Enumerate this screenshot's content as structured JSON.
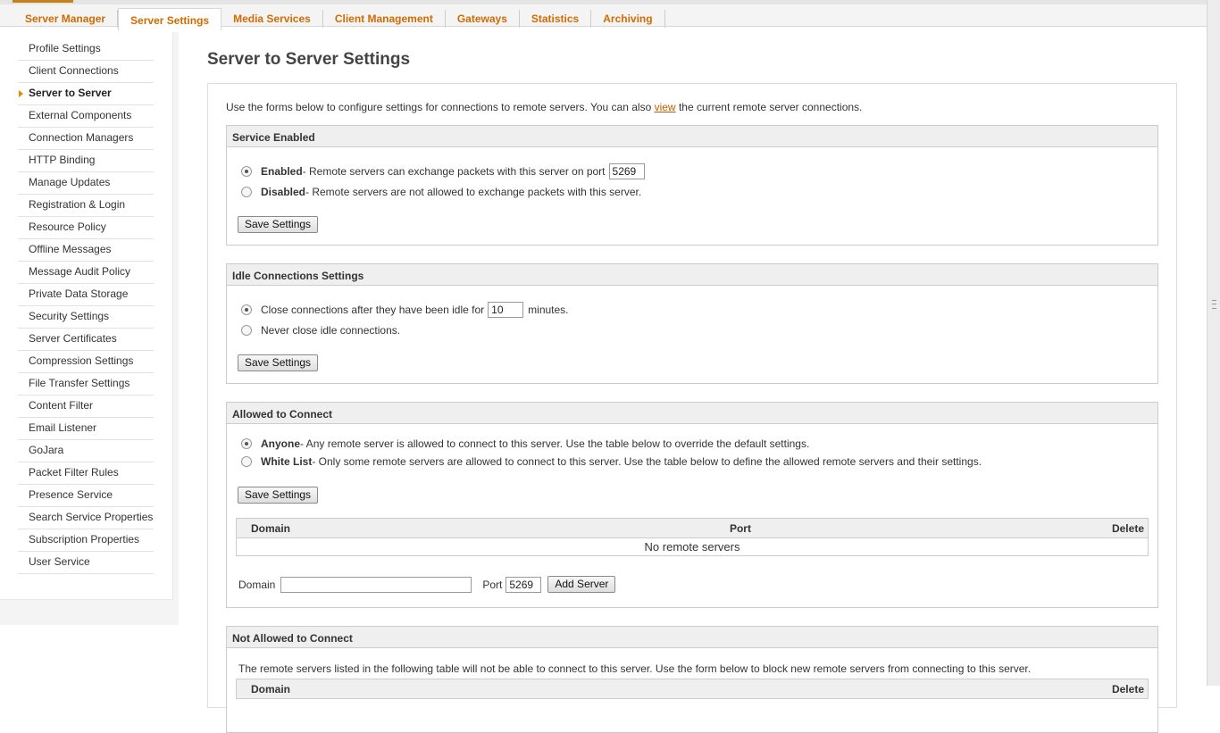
{
  "tabs": [
    {
      "label": "Server Manager",
      "active": false
    },
    {
      "label": "Server Settings",
      "active": true
    },
    {
      "label": "Media Services",
      "active": false
    },
    {
      "label": "Client Management",
      "active": false
    },
    {
      "label": "Gateways",
      "active": false
    },
    {
      "label": "Statistics",
      "active": false
    },
    {
      "label": "Archiving",
      "active": false
    }
  ],
  "sidebar": {
    "items": [
      {
        "label": "Profile Settings"
      },
      {
        "label": "Client Connections"
      },
      {
        "label": "Server to Server",
        "active": true
      },
      {
        "label": "External Components"
      },
      {
        "label": "Connection Managers"
      },
      {
        "label": "HTTP Binding"
      },
      {
        "label": "Manage Updates"
      },
      {
        "label": "Registration & Login"
      },
      {
        "label": "Resource Policy"
      },
      {
        "label": "Offline Messages"
      },
      {
        "label": "Message Audit Policy"
      },
      {
        "label": "Private Data Storage"
      },
      {
        "label": "Security Settings"
      },
      {
        "label": "Server Certificates"
      },
      {
        "label": "Compression Settings"
      },
      {
        "label": "File Transfer Settings"
      },
      {
        "label": "Content Filter"
      },
      {
        "label": "Email Listener"
      },
      {
        "label": "GoJara"
      },
      {
        "label": "Packet Filter Rules"
      },
      {
        "label": "Presence Service"
      },
      {
        "label": "Search Service Properties"
      },
      {
        "label": "Subscription Properties"
      },
      {
        "label": "User Service"
      }
    ]
  },
  "page": {
    "title": "Server to Server Settings",
    "intro_before": "Use the forms below to configure settings for connections to remote servers. You can also ",
    "intro_link": "view",
    "intro_after": " the current remote server connections."
  },
  "service_enabled": {
    "title": "Service Enabled",
    "enabled_label": "Enabled",
    "enabled_desc": " - Remote servers can exchange packets with this server on port",
    "port": "5269",
    "disabled_label": "Disabled",
    "disabled_desc": " - Remote servers are not allowed to exchange packets with this server.",
    "save_label": "Save Settings"
  },
  "idle": {
    "title": "Idle Connections Settings",
    "close_before": "Close connections after they have been idle for",
    "minutes_value": "10",
    "close_after": "minutes.",
    "never_label": "Never close idle connections.",
    "save_label": "Save Settings"
  },
  "allowed": {
    "title": "Allowed to Connect",
    "anyone_label": "Anyone",
    "anyone_desc": " - Any remote server is allowed to connect to this server. Use the table below to override the default settings.",
    "whitelist_label": "White List",
    "whitelist_desc": " - Only some remote servers are allowed to connect to this server. Use the table below to define the allowed remote servers and their settings.",
    "save_label": "Save Settings",
    "table_headers": {
      "domain": "Domain",
      "port": "Port",
      "delete": "Delete"
    },
    "empty_text": "No remote servers",
    "domain_label": "Domain",
    "domain_value": "",
    "port_label": "Port",
    "port_value": "5269",
    "add_label": "Add Server"
  },
  "not_allowed": {
    "title": "Not Allowed to Connect",
    "desc": "The remote servers listed in the following table will not be able to connect to this server. Use the form below to block new remote servers from connecting to this server.",
    "table_headers": {
      "domain": "Domain",
      "delete": "Delete"
    }
  },
  "colors": {
    "accent": "#d16b00",
    "link": "#c35a00",
    "section_header_bg": "#efefef"
  }
}
